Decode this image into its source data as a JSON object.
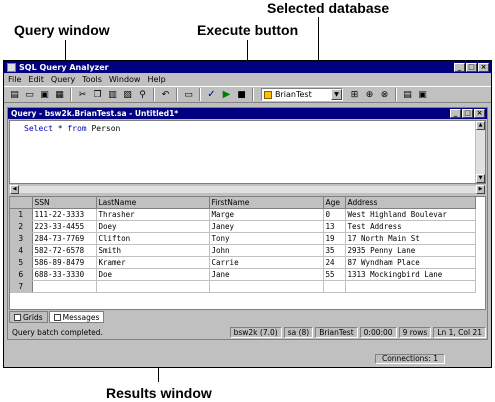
{
  "callouts": {
    "query_window": "Query window",
    "execute_button": "Execute button",
    "selected_database": "Selected database",
    "results_window": "Results window"
  },
  "app": {
    "title": "SQL Query Analyzer",
    "menu": [
      "File",
      "Edit",
      "Query",
      "Tools",
      "Window",
      "Help"
    ],
    "database": "BrianTest"
  },
  "query_window": {
    "title": "Query - bsw2k.BrianTest.sa - Untitled1*",
    "sql": {
      "kw_select": "Select",
      "star": " * ",
      "kw_from": "from",
      "table": " Person"
    }
  },
  "results": {
    "columns": [
      "",
      "SSN",
      "LastName",
      "FirstName",
      "Age",
      "Address"
    ],
    "rows": [
      [
        "1",
        "111-22-3333",
        "Thrasher",
        "Marge",
        "0",
        "West Highland Boulevar"
      ],
      [
        "2",
        "223-33-4455",
        "Doey",
        "Janey",
        "13",
        "Test Address"
      ],
      [
        "3",
        "284-73-7769",
        "Clifton",
        "Tony",
        "19",
        "17 North Main St"
      ],
      [
        "4",
        "582-72-6578",
        "Smith",
        "John",
        "35",
        "2935 Penny Lane"
      ],
      [
        "5",
        "586-89-8479",
        "Kramer",
        "Carrie",
        "24",
        "87 Wyndham Place"
      ],
      [
        "6",
        "688-33-3330",
        "Doe",
        "Jane",
        "55",
        "1313 Mockingbird Lane"
      ],
      [
        "7",
        "",
        "",
        "",
        "",
        ""
      ]
    ]
  },
  "tabs": [
    "Grids",
    "Messages"
  ],
  "query_status": {
    "message": "Query batch completed.",
    "server": "bsw2k (7.0)",
    "user": "sa (8)",
    "database": "BrianTest",
    "elapsed": "0:00:00",
    "rows": "9 rows",
    "position": "Ln 1, Col 21"
  },
  "app_status": {
    "connections": "Connections: 1"
  }
}
